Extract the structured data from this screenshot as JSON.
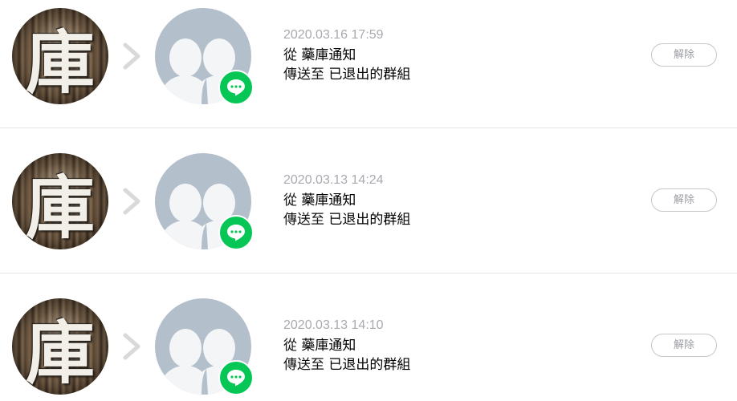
{
  "records": [
    {
      "time": "2020.03.16 17:59",
      "from_prefix": "從",
      "from_name": "藥庫通知",
      "to_prefix": "傳送至",
      "to_target": "已退出的群組",
      "button_label": "解除",
      "avatar_glyph": "庫"
    },
    {
      "time": "2020.03.13 14:24",
      "from_prefix": "從",
      "from_name": "藥庫通知",
      "to_prefix": "傳送至",
      "to_target": "已退出的群組",
      "button_label": "解除",
      "avatar_glyph": "庫"
    },
    {
      "time": "2020.03.13 14:10",
      "from_prefix": "從",
      "from_name": "藥庫通知",
      "to_prefix": "傳送至",
      "to_target": "已退出的群組",
      "button_label": "解除",
      "avatar_glyph": "庫"
    }
  ],
  "colors": {
    "badge_green": "#06c755",
    "group_avatar_gray": "#b3bfcb",
    "timestamp_gray": "#a8aab0",
    "button_border": "#c4c6ca"
  },
  "icons": {
    "service_avatar": "warehouse-photo-avatar",
    "arrow": "chevron-right-icon",
    "group_avatar": "group-silhouette-icon",
    "badge": "line-chat-bubble-icon"
  }
}
